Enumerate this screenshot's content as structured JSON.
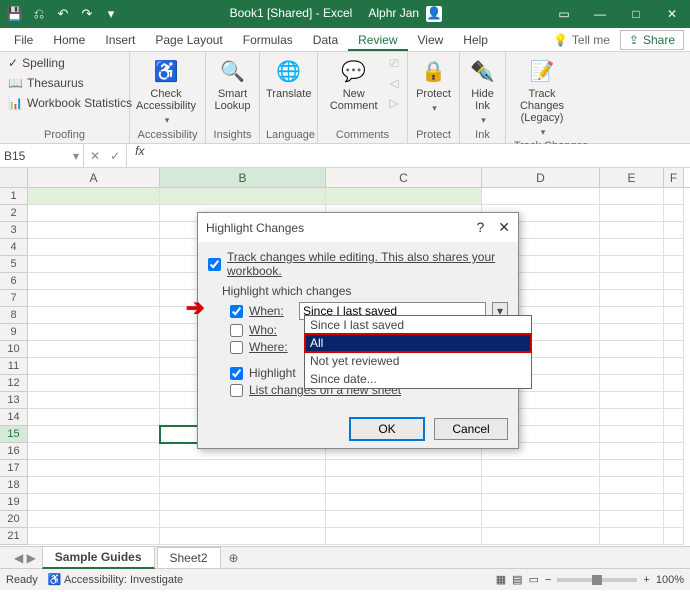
{
  "titlebar": {
    "title": "Book1 [Shared] - Excel",
    "user": "Alphr Jan"
  },
  "tabs": {
    "file": "File",
    "home": "Home",
    "insert": "Insert",
    "pagelayout": "Page Layout",
    "formulas": "Formulas",
    "data": "Data",
    "review": "Review",
    "view": "View",
    "help": "Help",
    "tellme": "Tell me",
    "share": "Share"
  },
  "ribbon": {
    "proofing": {
      "spelling": "Spelling",
      "thesaurus": "Thesaurus",
      "workbook_stats": "Workbook Statistics",
      "label": "Proofing"
    },
    "accessibility": {
      "btn": "Check Accessibility",
      "label": "Accessibility"
    },
    "insights": {
      "btn": "Smart Lookup",
      "label": "Insights"
    },
    "language": {
      "btn": "Translate",
      "label": "Language"
    },
    "comments": {
      "btn": "New Comment",
      "label": "Comments"
    },
    "protect": {
      "btn": "Protect",
      "label": "Protect"
    },
    "ink": {
      "btn": "Hide Ink",
      "label": "Ink"
    },
    "trackchanges": {
      "btn": "Track Changes (Legacy)",
      "label": "Track Changes"
    }
  },
  "namebox": "B15",
  "columns": {
    "A": "A",
    "B": "B",
    "C": "C",
    "D": "D",
    "E": "E",
    "F": "F"
  },
  "col_widths": {
    "A": 132,
    "B": 166,
    "C": 156,
    "D": 118,
    "E": 64,
    "F": 20
  },
  "sheets": {
    "guides": "Sample Guides",
    "sheet2": "Sheet2"
  },
  "statusbar": {
    "ready": "Ready",
    "acc": "Accessibility: Investigate",
    "zoom": "100%"
  },
  "dialog": {
    "title": "Highlight Changes",
    "track_label": "Track changes while editing. This also shares your workbook.",
    "sub": "Highlight which changes",
    "when_label": "When:",
    "when_value": "Since I last saved",
    "who_label": "Who:",
    "where_label": "Where:",
    "highlight_screen": "Highlight",
    "list_sheet": "List changes on a new sheet",
    "ok": "OK",
    "cancel": "Cancel",
    "options": {
      "o1": "Since I last saved",
      "o2": "All",
      "o3": "Not yet reviewed",
      "o4": "Since date..."
    }
  }
}
